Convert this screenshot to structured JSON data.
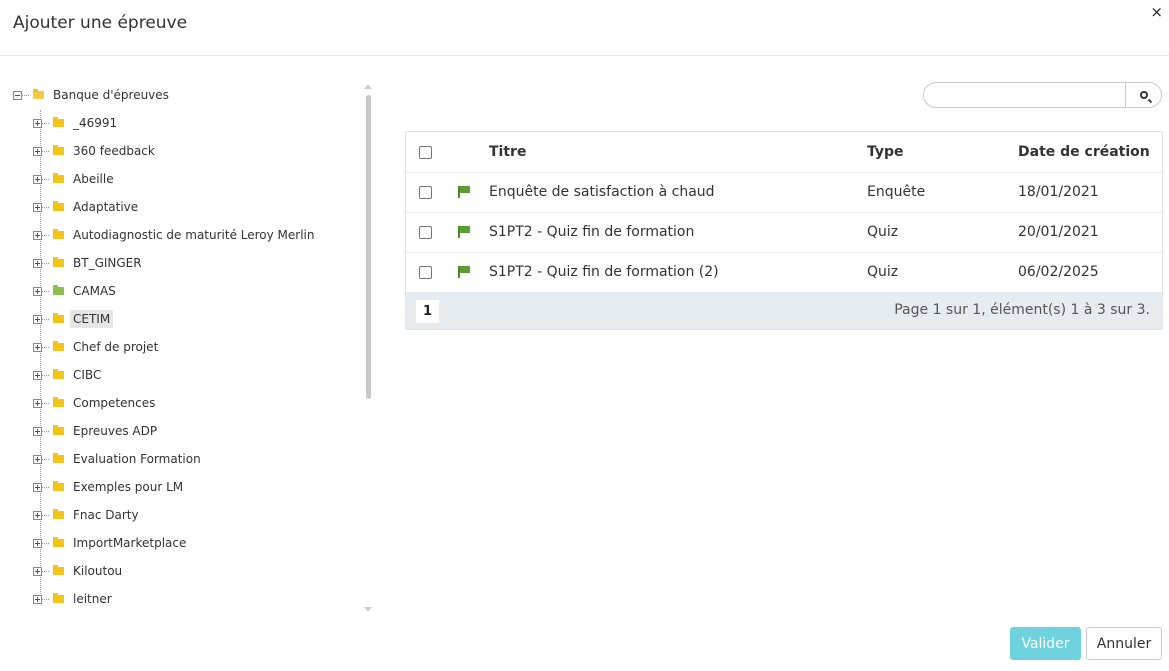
{
  "dialog": {
    "title": "Ajouter une épreuve",
    "close_label": "×"
  },
  "tree": {
    "root": {
      "label": "Banque d'épreuves"
    },
    "items": [
      {
        "label": "_46991",
        "folder_color": "yellow"
      },
      {
        "label": "360 feedback",
        "folder_color": "yellow"
      },
      {
        "label": "Abeille",
        "folder_color": "yellow"
      },
      {
        "label": "Adaptative",
        "folder_color": "yellow"
      },
      {
        "label": "Autodiagnostic de maturité Leroy Merlin",
        "folder_color": "yellow"
      },
      {
        "label": "BT_GINGER",
        "folder_color": "yellow"
      },
      {
        "label": "CAMAS",
        "folder_color": "green"
      },
      {
        "label": "CETIM",
        "folder_color": "yellow",
        "selected": true
      },
      {
        "label": "Chef de projet",
        "folder_color": "yellow"
      },
      {
        "label": "CIBC",
        "folder_color": "yellow"
      },
      {
        "label": "Competences",
        "folder_color": "yellow"
      },
      {
        "label": "Epreuves ADP",
        "folder_color": "yellow"
      },
      {
        "label": "Evaluation Formation",
        "folder_color": "yellow"
      },
      {
        "label": "Exemples pour LM",
        "folder_color": "yellow"
      },
      {
        "label": "Fnac Darty",
        "folder_color": "yellow"
      },
      {
        "label": "ImportMarketplace",
        "folder_color": "yellow"
      },
      {
        "label": "Kiloutou",
        "folder_color": "yellow"
      },
      {
        "label": "leitner",
        "folder_color": "yellow"
      }
    ]
  },
  "search": {
    "placeholder": "",
    "value": ""
  },
  "table": {
    "headers": {
      "title": "Titre",
      "type": "Type",
      "date": "Date de création"
    },
    "rows": [
      {
        "title": "Enquête de satisfaction à chaud",
        "type": "Enquête",
        "date": "18/01/2021"
      },
      {
        "title": "S1PT2 - Quiz fin de formation",
        "type": "Quiz",
        "date": "20/01/2021"
      },
      {
        "title": "S1PT2 - Quiz fin de formation (2)",
        "type": "Quiz",
        "date": "06/02/2025"
      }
    ],
    "pager": {
      "current_page": "1",
      "info": "Page 1 sur 1, élément(s) 1 à 3 sur 3."
    }
  },
  "footer": {
    "validate_label": "Valider",
    "cancel_label": "Annuler"
  },
  "colors": {
    "accent": "#6fd3df",
    "folder": "#f2c418",
    "folder_green": "#8cc152",
    "flag": "#5a9e33",
    "pager_bg": "#e7ecf0"
  }
}
